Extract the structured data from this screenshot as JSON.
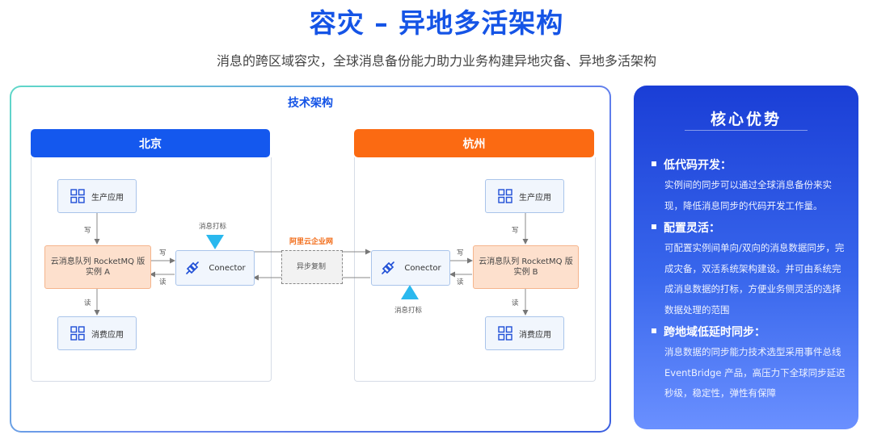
{
  "header": {
    "title": "容灾 – 异地多活架构",
    "subtitle": "消息的跨区域容灾，全球消息备份能力助力业务构建异地灾备、异地多活架构"
  },
  "diagram": {
    "section_title": "技术架构",
    "beijing": {
      "header": "北京",
      "producer": "生产应用",
      "consumer": "消费应用",
      "mq": [
        "云消息队列 RocketMQ 版",
        "实例 A"
      ],
      "connector": "Conector",
      "marker_label": "消息打标",
      "write_label": "写",
      "read_label": "读",
      "conn_write_label": "写",
      "conn_read_label": "读"
    },
    "hangzhou": {
      "header": "杭州",
      "producer": "生产应用",
      "consumer": "消费应用",
      "mq": [
        "云消息队列 RocketMQ 版",
        "实例 B"
      ],
      "connector": "Conector",
      "marker_label": "消息打标",
      "write_label": "写",
      "read_label": "读",
      "conn_write_label": "写",
      "conn_read_label": "读"
    },
    "wan_label": "阿里云企业网",
    "replication_label": "异步复制"
  },
  "advantages": {
    "title": "核心优势",
    "items": [
      {
        "head": "低代码开发",
        "body": "实例间的同步可以通过全球消息备份来实现，降低消息同步的代码开发工作量。"
      },
      {
        "head": "配置灵活",
        "body": "可配置实例间单向/双向的消息数据同步，完成灾备，双活系统架构建设。并可由系统完成消息数据的打标，方便业务侧灵活的选择数据处理的范围"
      },
      {
        "head": "跨地域低延时同步",
        "body": "消息数据的同步能力技术选型采用事件总线 EventBridge 产品，高压力下全球同步延迟秒级，稳定性，弹性有保障"
      }
    ]
  },
  "colors": {
    "accent_blue": "#1458ee",
    "accent_orange": "#fb6a12",
    "marker_cyan": "#2ab8ee"
  }
}
